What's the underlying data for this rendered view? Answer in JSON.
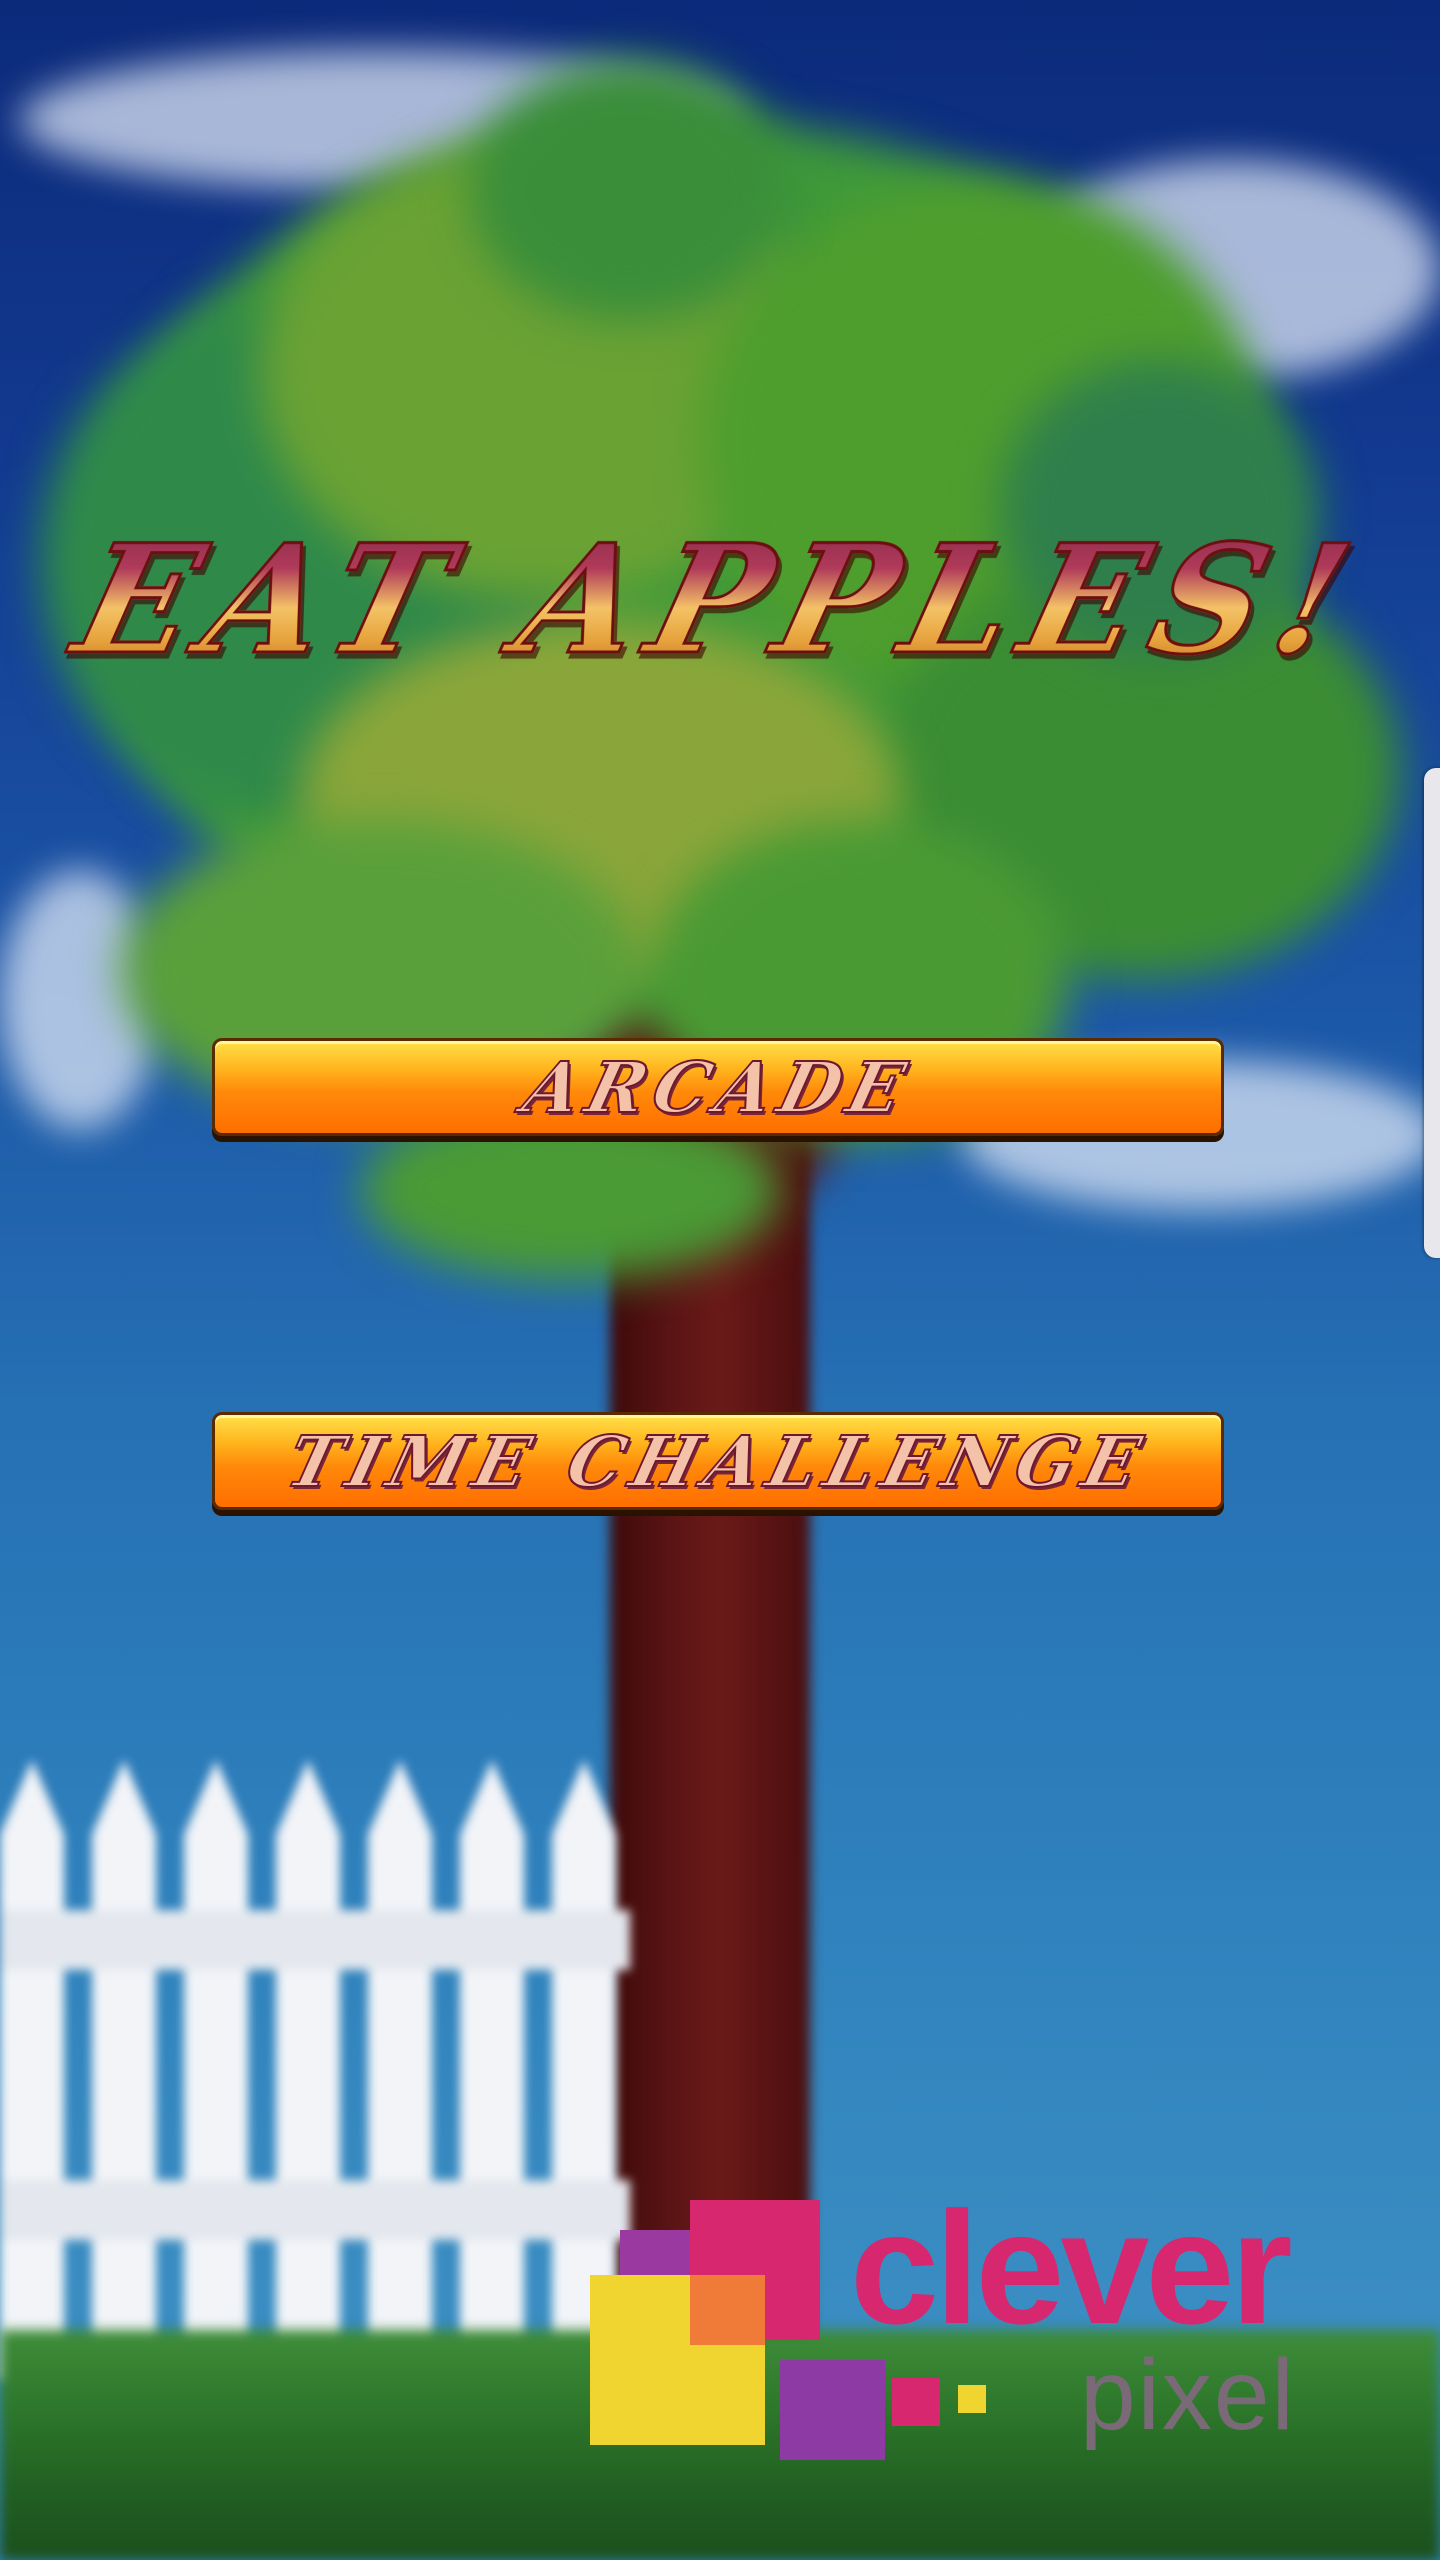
{
  "game": {
    "title": "EAT APPLES!",
    "buttons": {
      "arcade": "ARCADE",
      "time_challenge": "TIME CHALLENGE"
    },
    "publisher_logo": {
      "word": "clever",
      "sub": "pixel"
    }
  },
  "colors": {
    "sky_top": "#0c2a7a",
    "sky_bottom": "#3a8dc2",
    "button_orange": "#ff8a0a",
    "button_yellow": "#ffe14a",
    "logo_magenta": "#d6276f",
    "logo_gray": "#7a6a78"
  }
}
